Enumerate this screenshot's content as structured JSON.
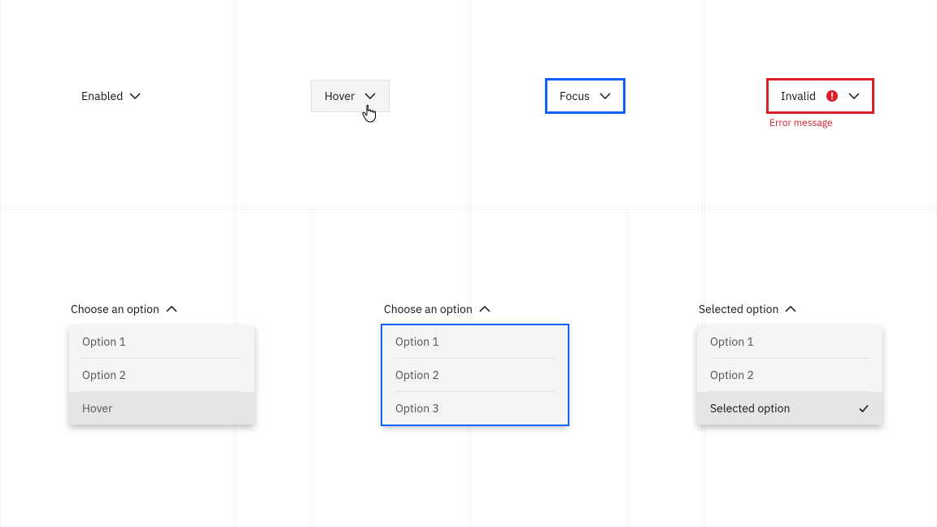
{
  "triggers": {
    "enabled": "Enabled",
    "hover": "Hover",
    "focus": "Focus",
    "invalid": "Invalid"
  },
  "error_message": "Error message",
  "menus": {
    "open_hover": {
      "label": "Choose an option",
      "items": [
        "Option 1",
        "Option 2",
        "Hover"
      ]
    },
    "open_focus": {
      "label": "Choose an option",
      "items": [
        "Option 1",
        "Option 2",
        "Option 3"
      ]
    },
    "open_selected": {
      "label": "Selected option",
      "items": [
        "Option 1",
        "Option 2",
        "Selected option"
      ]
    }
  }
}
